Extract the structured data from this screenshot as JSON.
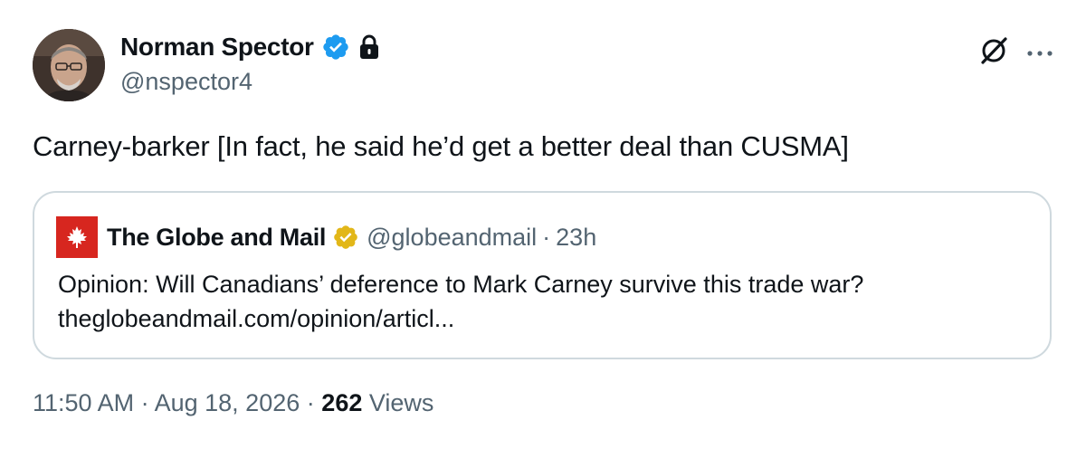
{
  "author": {
    "name": "Norman Spector",
    "handle": "@nspector4",
    "verified_color": "#1d9bf0"
  },
  "tweet": {
    "text": "Carney-barker [In fact, he said he’d get a better deal than CUSMA]"
  },
  "quote": {
    "name": "The Globe and Mail",
    "handle": "@globeandmail",
    "separator": "·",
    "time": "23h",
    "body_line1": "Opinion: Will Canadians’ deference to Mark Carney survive this trade war?",
    "body_line2": "theglobeandmail.com/opinion/articl...",
    "logo_color": "#d7261f",
    "badge_color": "#e2b719"
  },
  "meta": {
    "time": "11:50 AM",
    "separator": "·",
    "date": "Aug 18, 2026",
    "views_count": "262",
    "views_label": "Views"
  },
  "icons": {
    "verified": "verified-badge-icon",
    "lock": "lock-icon",
    "grok": "grok-icon",
    "more": "more-icon",
    "maple_leaf": "maple-leaf-icon",
    "gold_badge": "gold-verified-badge-icon"
  }
}
